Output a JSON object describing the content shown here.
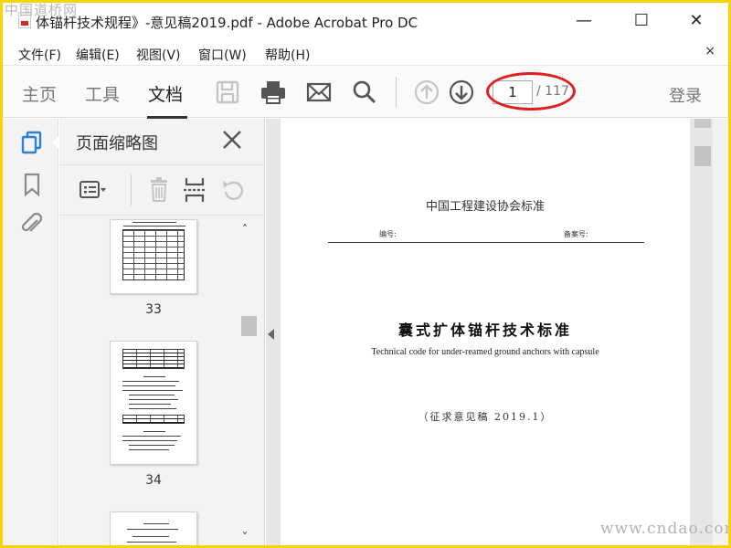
{
  "watermarks": {
    "top": "中国道桥网",
    "bottom": "www.cndao.com"
  },
  "window": {
    "title": "体锚杆技术规程》-意见稿2019.pdf - Adobe Acrobat Pro DC",
    "minimize": "—",
    "maximize": "☐",
    "close": "✕"
  },
  "menu": {
    "items": [
      {
        "label": "文件(F)"
      },
      {
        "label": "编辑(E)"
      },
      {
        "label": "视图(V)"
      },
      {
        "label": "窗口(W)"
      },
      {
        "label": "帮助(H)"
      }
    ],
    "close": "×"
  },
  "toolbar": {
    "tabs": [
      {
        "label": "主页",
        "active": false
      },
      {
        "label": "工具",
        "active": false
      },
      {
        "label": "文档",
        "active": true
      }
    ],
    "icons": [
      "save-icon",
      "print-icon",
      "email-icon",
      "search-icon",
      "prev-page-icon",
      "next-page-icon"
    ],
    "page_current": "1",
    "page_total": "/ 117",
    "login": "登录",
    "highlight_color": "#e01e1e"
  },
  "sidebar": {
    "icons": [
      "page-thumbnails-icon",
      "bookmark-icon",
      "attachment-icon"
    ],
    "accent": "#2d7fd3"
  },
  "thumbnail_panel": {
    "title": "页面缩略图",
    "tools": [
      "options-icon",
      "delete-icon",
      "insert-page-icon",
      "rotate-icon"
    ],
    "thumbnails": [
      {
        "page": "33"
      },
      {
        "page": "34"
      },
      {
        "page": ""
      }
    ]
  },
  "document": {
    "org": "中国工程建设协会标准",
    "code_label": "编号:",
    "record_label": "备案号:",
    "title": "囊式扩体锚杆技术标准",
    "subtitle": "Technical code for under-reamed ground anchors with capsule",
    "draft": "（征求意见稿 2019.1）"
  }
}
